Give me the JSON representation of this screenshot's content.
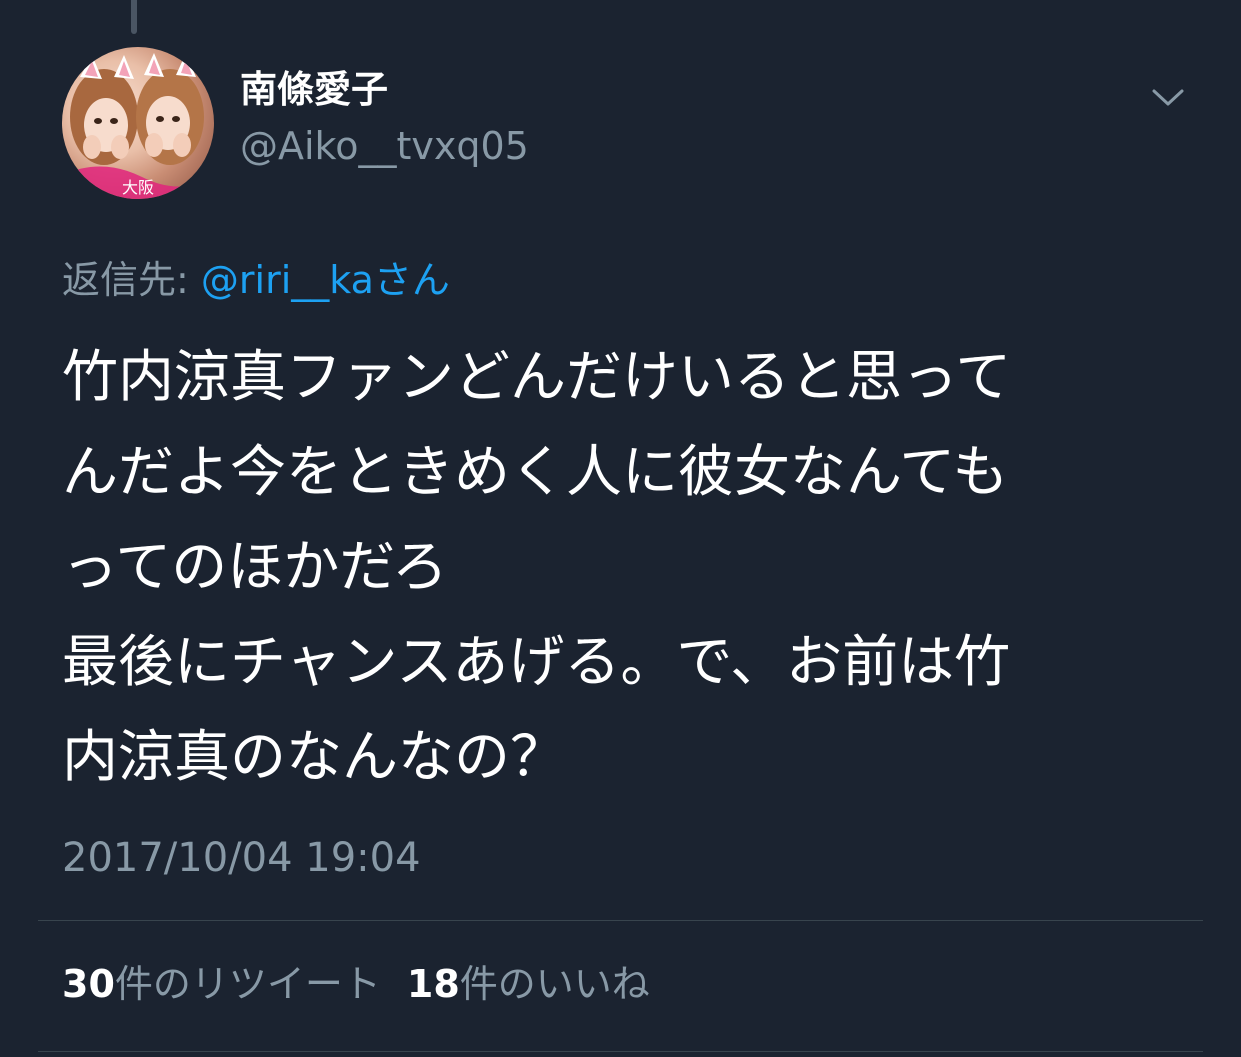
{
  "tweet": {
    "author": {
      "display_name": "南條愛子",
      "handle": "@Aiko__tvxq05",
      "avatar_icon": "profile-photo",
      "avatar_sticker_text": "大阪"
    },
    "menu_icon": "chevron-down-icon",
    "reply": {
      "prefix": "返信先: ",
      "mention": "@riri__kaさん"
    },
    "text_lines": [
      "竹内涼真ファンどんだけいると思って",
      "んだよ今をときめく人に彼女なんても",
      "ってのほかだろ",
      "最後にチャンスあげる。で、お前は竹",
      "内涼真のなんなの？"
    ],
    "timestamp": "2017/10/04 19:04",
    "stats": {
      "retweets_count": "30",
      "retweets_label": "件のリツイート",
      "likes_count": "18",
      "likes_label": "件のいいね"
    }
  },
  "colors": {
    "background": "#1b2330",
    "secondary_text": "#8899a6",
    "link": "#1da1f2",
    "divider": "#38444d"
  }
}
